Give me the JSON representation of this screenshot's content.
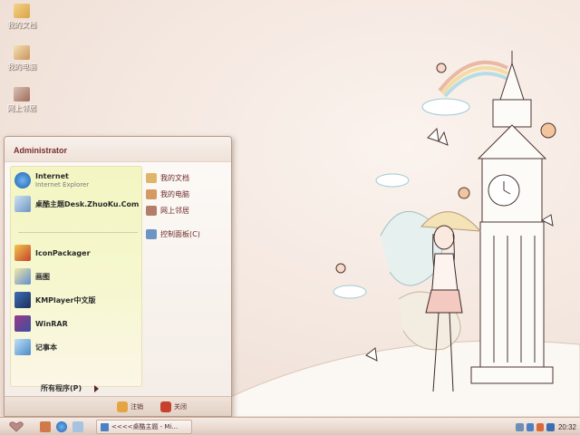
{
  "desktop": {
    "icons": [
      {
        "label": "我的文档"
      },
      {
        "label": "我的电脑"
      },
      {
        "label": "网上邻居"
      }
    ]
  },
  "start_menu": {
    "user": "Administrator",
    "pinned": [
      {
        "label": "Internet",
        "sub": "Internet Explorer",
        "icon": "internet-explorer-icon"
      },
      {
        "label": "桌酷主题Desk.ZhuoKu.Com",
        "icon": "zhuoku-theme-icon"
      }
    ],
    "recent": [
      {
        "label": "IconPackager",
        "icon": "iconpackager-icon"
      },
      {
        "label": "画图",
        "icon": "paint-icon"
      },
      {
        "label": "KMPlayer中文版",
        "icon": "kmplayer-icon"
      },
      {
        "label": "WinRAR",
        "icon": "winrar-icon"
      },
      {
        "label": "记事本",
        "icon": "notepad-icon"
      }
    ],
    "all_programs": "所有程序(P)",
    "right_items": [
      {
        "label": "我的文档",
        "icon": "my-documents-icon"
      },
      {
        "label": "我的电脑",
        "icon": "my-computer-icon"
      },
      {
        "label": "网上邻居",
        "icon": "network-icon"
      },
      {
        "label": "控制面板(C)",
        "icon": "control-panel-icon"
      }
    ],
    "footer": {
      "logoff": "注销",
      "shutdown": "关闭"
    }
  },
  "taskbar": {
    "task_label": "<<<<桌酷主题 - Mi...",
    "clock": "20:32"
  },
  "colors": {
    "accent": "#7b2e2e",
    "pinned_bg": "#f3f6c2",
    "taskbar": "#e9d9cf"
  }
}
